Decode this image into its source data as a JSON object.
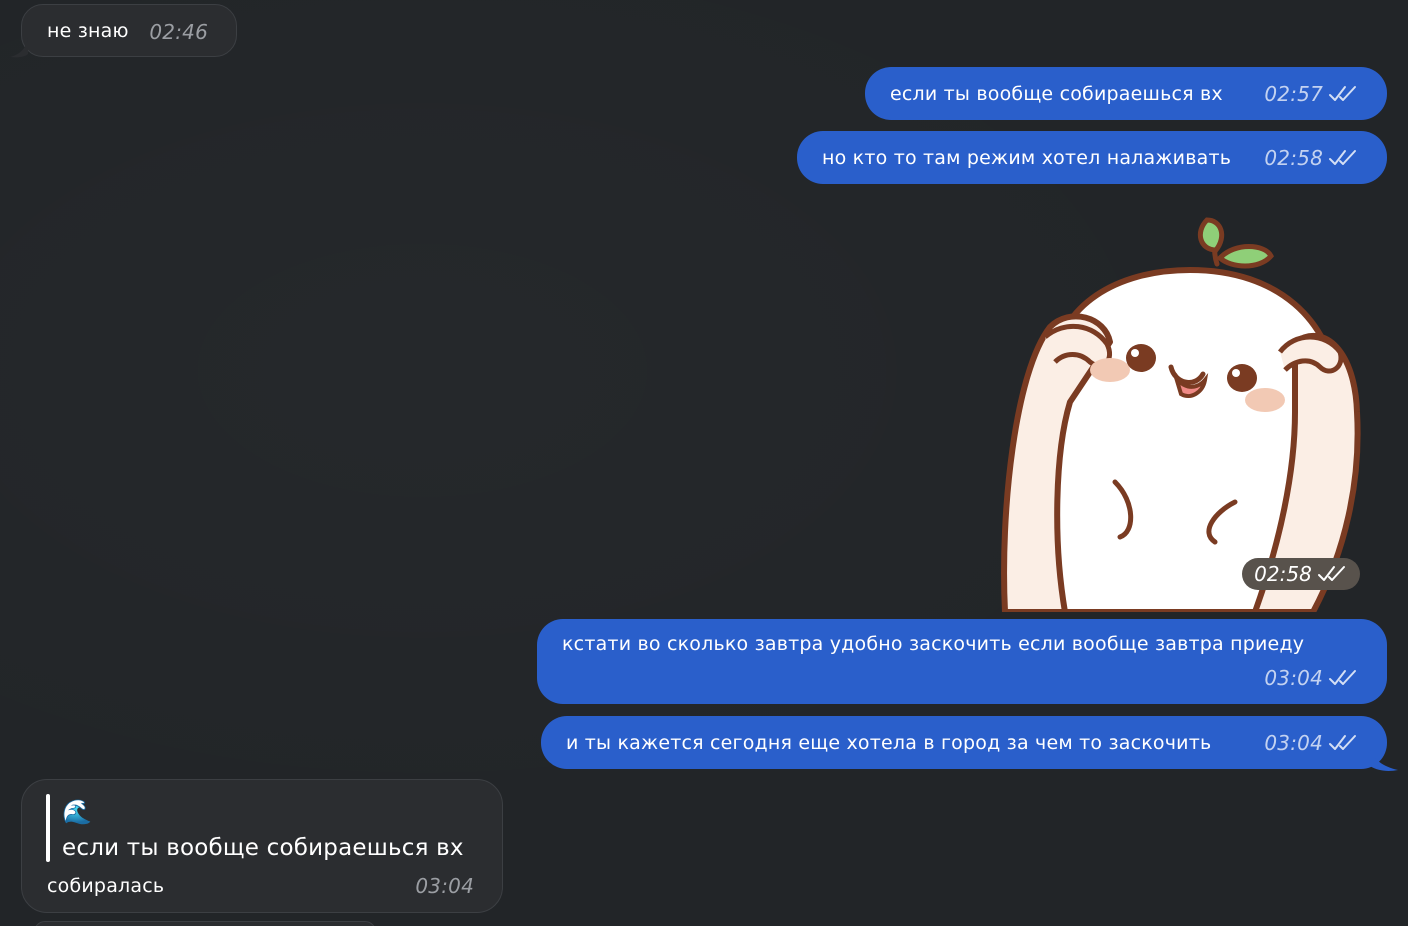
{
  "messages": [
    {
      "id": "m1",
      "direction": "incoming",
      "text": "не знаю",
      "time": "02:46"
    },
    {
      "id": "m2",
      "direction": "outgoing",
      "text": "если ты вообще собираешься вх",
      "time": "02:57",
      "status": "read"
    },
    {
      "id": "m3",
      "direction": "outgoing",
      "text": "но кто то там режим хотел налаживать",
      "time": "02:58",
      "status": "read"
    },
    {
      "id": "m4",
      "direction": "outgoing",
      "type": "sticker",
      "time": "02:58",
      "status": "read"
    },
    {
      "id": "m5",
      "direction": "outgoing",
      "text": "кстати во сколько завтра удобно заскочить если вообще завтра приеду",
      "time": "03:04",
      "status": "read"
    },
    {
      "id": "m6",
      "direction": "outgoing",
      "text": "и ты кажется сегодня еще хотела в город за чем то заскочить",
      "time": "03:04",
      "status": "read"
    },
    {
      "id": "m7",
      "direction": "incoming",
      "reply": {
        "emoji": "🌊",
        "quoted_text": "если ты вообще собираешься вх"
      },
      "text": "собиралась",
      "time": "03:04"
    }
  ],
  "colors": {
    "background": "#222528",
    "outgoing_bubble": "#2a5fcb",
    "incoming_bubble": "#2b2d30",
    "sticker_time_pill": "#58524c"
  },
  "icons": {
    "read_status": "double-check-icon",
    "sticker": "sprout-mochi-sticker"
  }
}
